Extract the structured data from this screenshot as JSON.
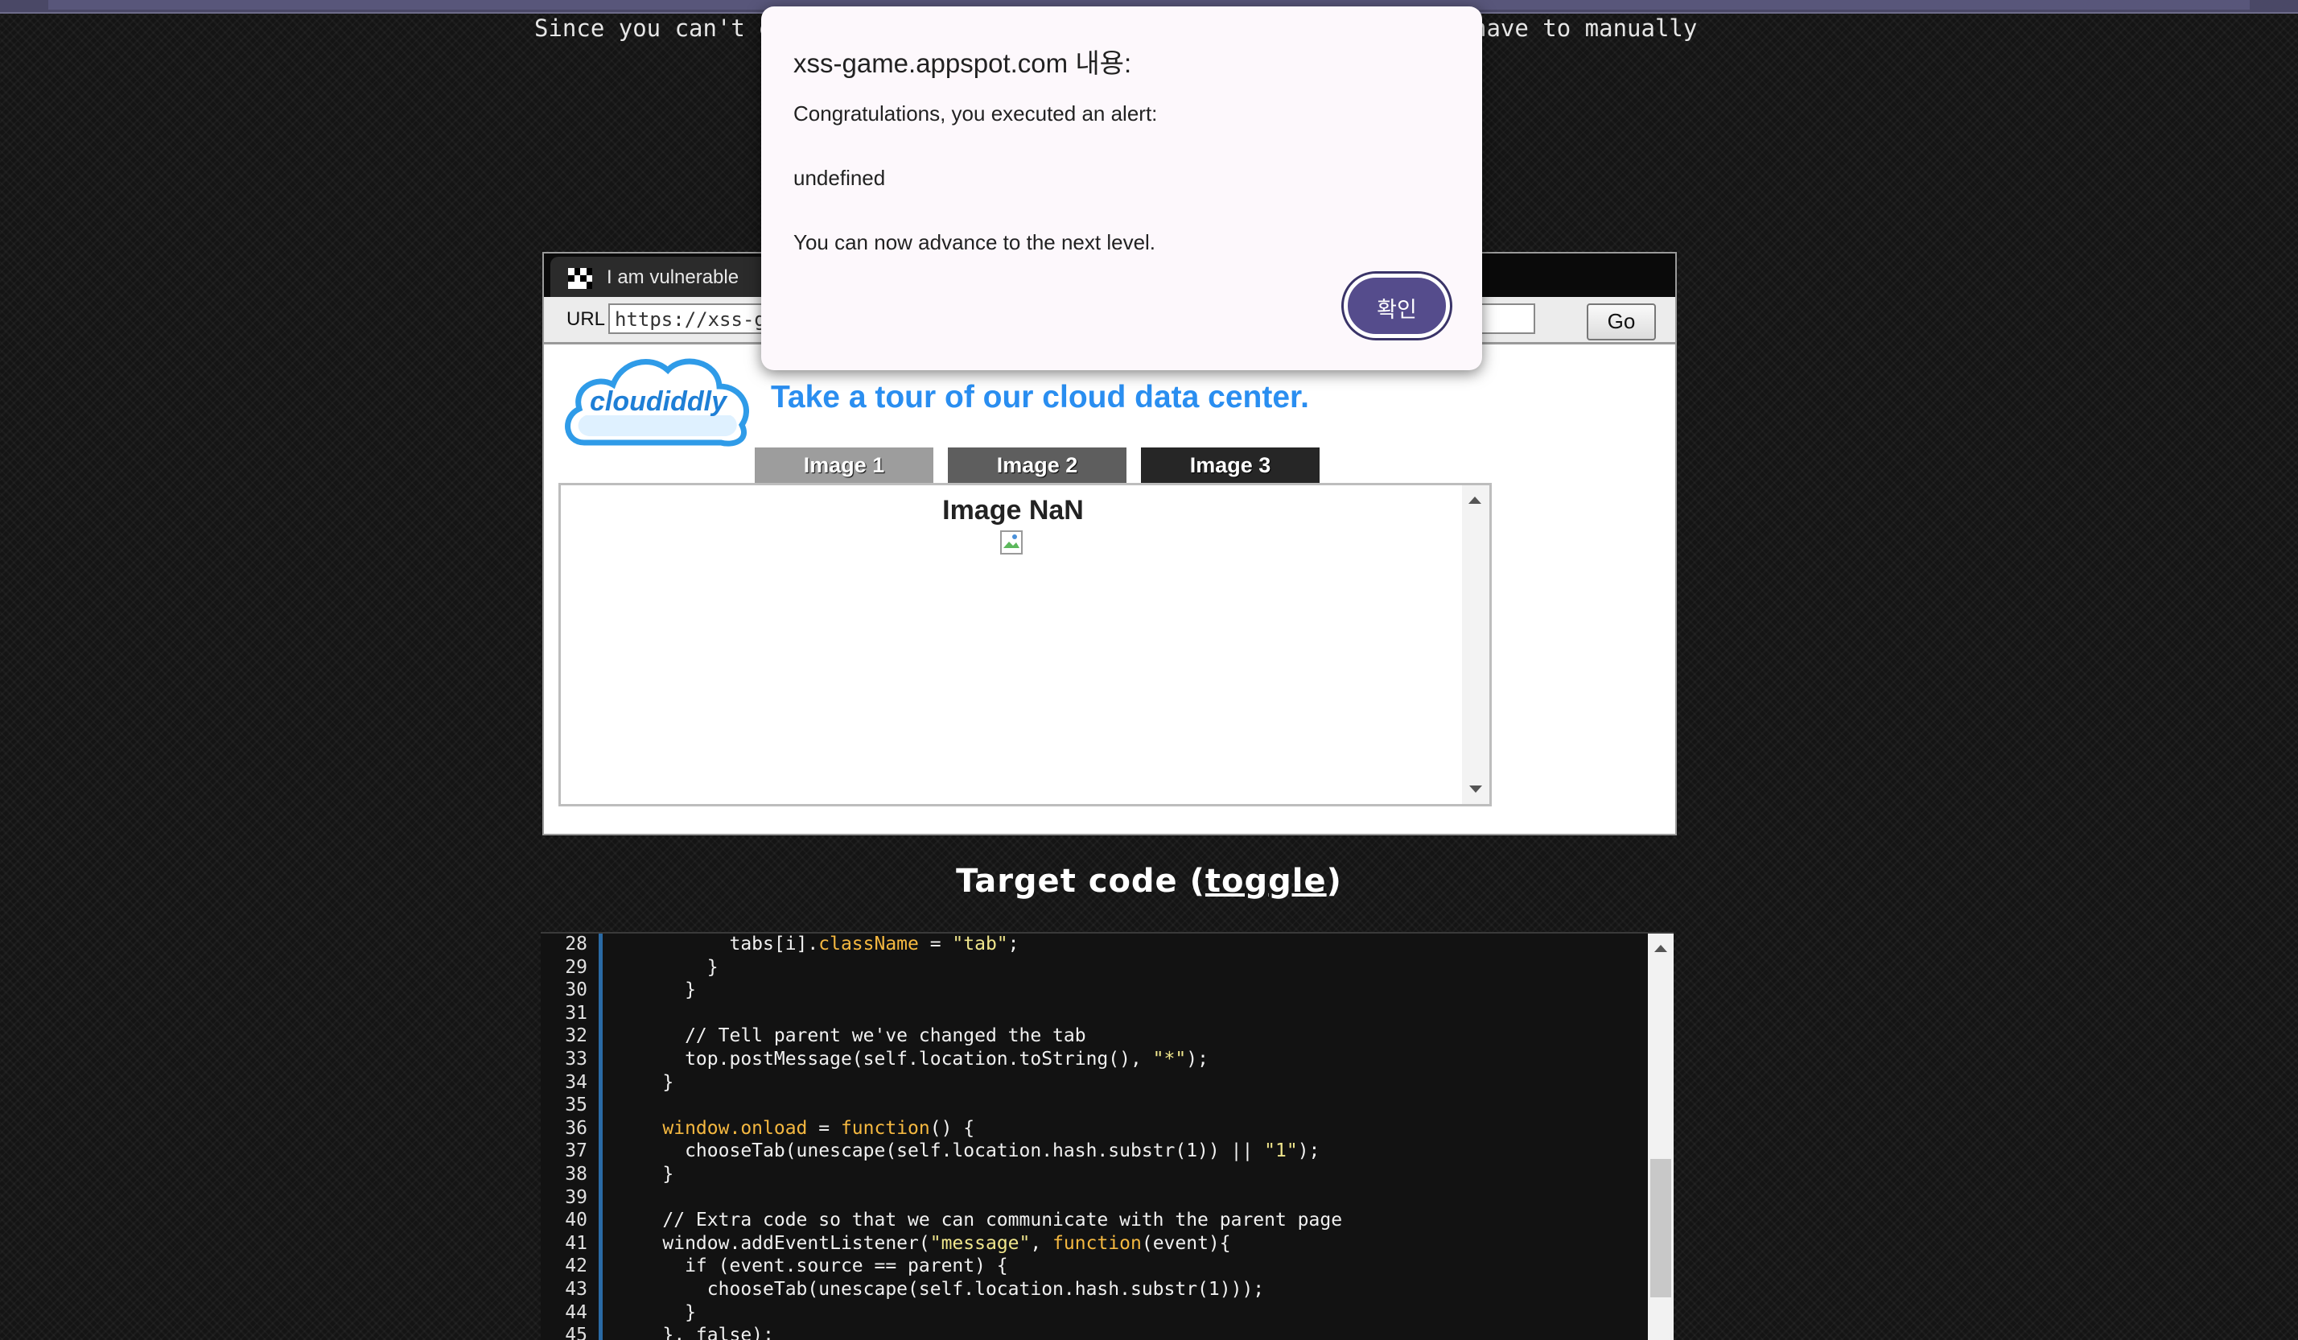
{
  "intro": {
    "left_text": "Since you can't en",
    "right_text": "have to manually"
  },
  "browser": {
    "tab_title": "I am vulnerable",
    "url_label": "URL",
    "url_value": "https://xss-ga",
    "go_label": "Go"
  },
  "page": {
    "logo_text": "cloudiddly",
    "headline": "Take a tour of our cloud data center.",
    "tabs": [
      "Image 1",
      "Image 2",
      "Image 3"
    ],
    "frame_title": "Image NaN"
  },
  "dialog": {
    "title": "xss-game.appspot.com 내용:",
    "line1": "Congratulations, you executed an alert:",
    "line2": "undefined",
    "line3": "You can now advance to the next level.",
    "ok_label": "확인"
  },
  "target": {
    "heading_prefix": "Target code (",
    "toggle_label": "toggle",
    "heading_suffix": ")"
  },
  "code": {
    "line_numbers": [
      "28",
      "29",
      "30",
      "31",
      "32",
      "33",
      "34",
      "35",
      "36",
      "37",
      "38",
      "39",
      "40",
      "41",
      "42",
      "43",
      "44",
      "45"
    ],
    "lines": [
      "          tabs[i].className = \"tab\";",
      "        }",
      "      }",
      "",
      "      // Tell parent we've changed the tab",
      "      top.postMessage(self.location.toString(), \"*\");",
      "    }",
      "",
      "    window.onload = function() {",
      "      chooseTab(unescape(self.location.hash.substr(1)) || \"1\");",
      "    }",
      "",
      "    // Extra code so that we can communicate with the parent page",
      "    window.addEventListener(\"message\", function(event){",
      "      if (event.source == parent) {",
      "        chooseTab(unescape(self.location.hash.substr(1)));",
      "      }",
      "    }, false);"
    ]
  },
  "colors": {
    "accent_blue": "#2a8ef0",
    "dialog_button": "#554c8c",
    "code_keyword": "#f5b840",
    "code_string": "#f0e68c",
    "gutter_border": "#2a6aa5"
  }
}
